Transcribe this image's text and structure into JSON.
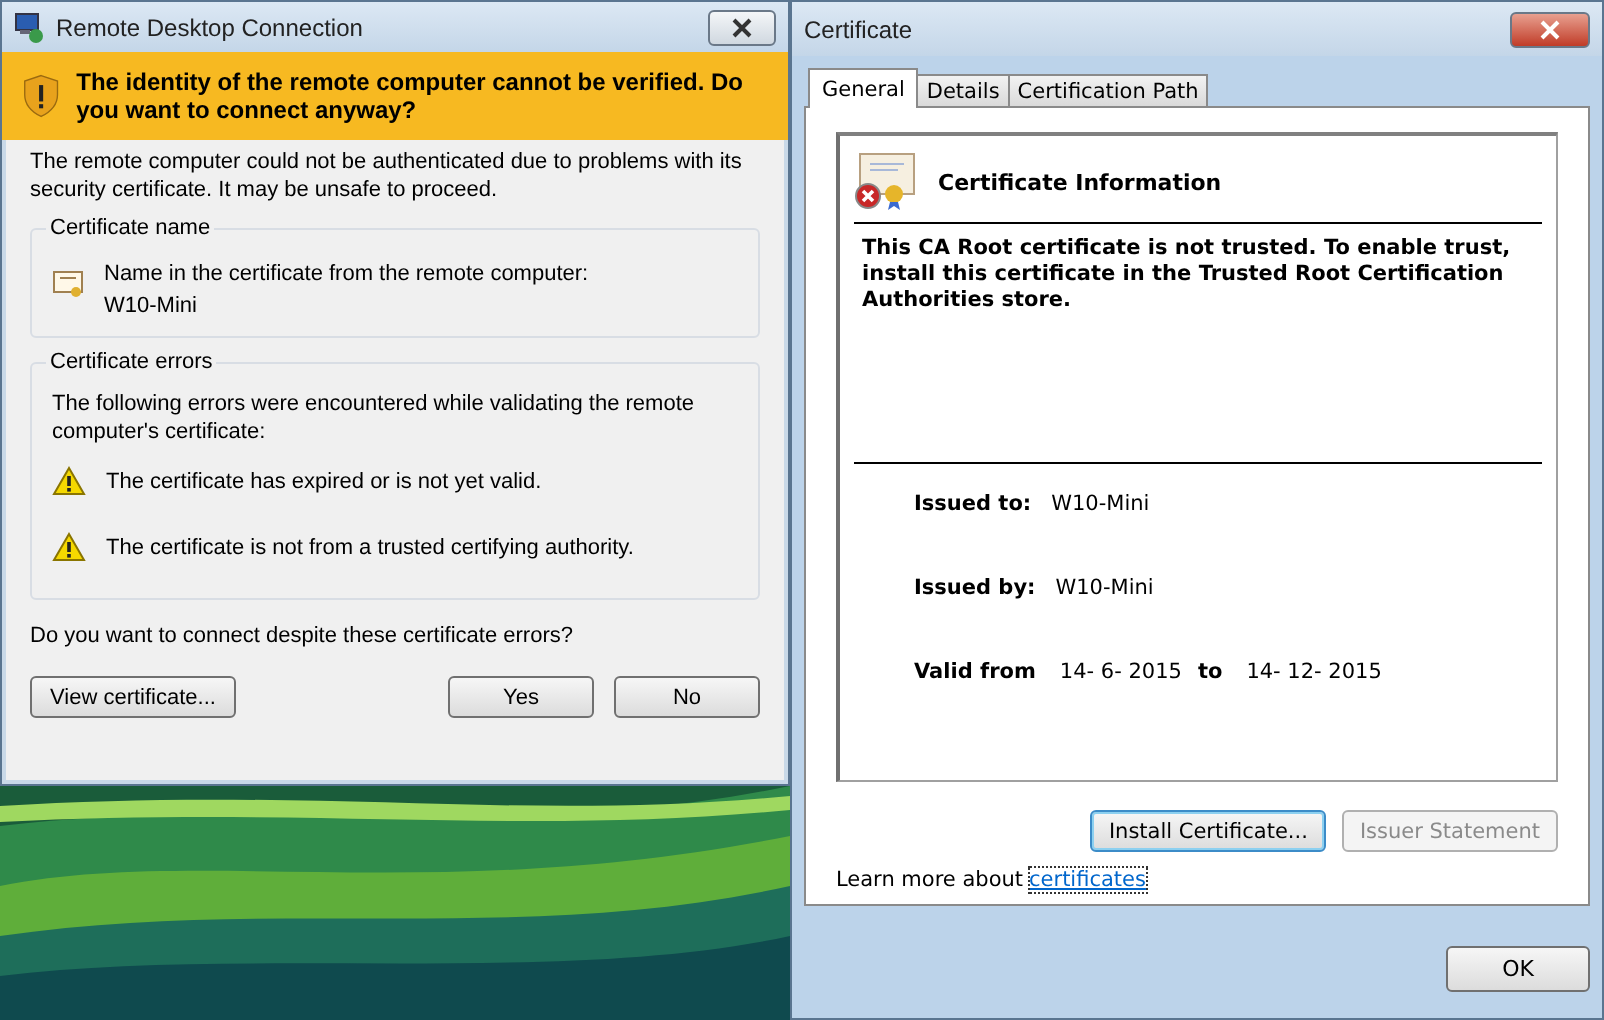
{
  "rdp_window": {
    "title": "Remote Desktop Connection",
    "warning": "The identity of the remote computer cannot be verified. Do you want to connect anyway?",
    "intro": "The remote computer could not be authenticated due to problems with its security certificate. It may be unsafe to proceed.",
    "name_group": {
      "title": "Certificate name",
      "label": "Name in the certificate from the remote computer:",
      "value": "W10-Mini"
    },
    "errors_group": {
      "title": "Certificate errors",
      "intro": "The following errors were encountered while validating the remote computer's certificate:",
      "errors": [
        "The certificate has expired or is not yet valid.",
        "The certificate is not from a trusted certifying authority."
      ]
    },
    "question": "Do you want to connect despite these certificate errors?",
    "buttons": [
      {
        "label": "View certificate..."
      },
      {
        "label": "Yes"
      },
      {
        "label": "No"
      }
    ]
  },
  "certificate_window": {
    "title": "Certificate",
    "tabs": [
      {
        "label": "General",
        "selected": true
      },
      {
        "label": "Details",
        "selected": false
      },
      {
        "label": "Certification Path",
        "selected": false
      }
    ],
    "heading": "Certificate Information",
    "message": "This CA Root certificate is not trusted. To enable trust, install this certificate in the Trusted Root Certification Authorities store.",
    "fields": [
      {
        "label": "Issued to:",
        "value": "W10-Mini"
      },
      {
        "label": "Issued by:",
        "value": "W10-Mini"
      }
    ],
    "validity": {
      "label": "Valid from",
      "from": "14- 6- 2015",
      "to_label": "to",
      "to": "14- 12- 2015"
    },
    "buttons": [
      {
        "label": "Install Certificate...",
        "disabled": false
      },
      {
        "label": "Issuer Statement",
        "disabled": true
      }
    ],
    "learn_more": {
      "text": "Learn more about",
      "link": "certificates"
    },
    "ok": "OK"
  }
}
